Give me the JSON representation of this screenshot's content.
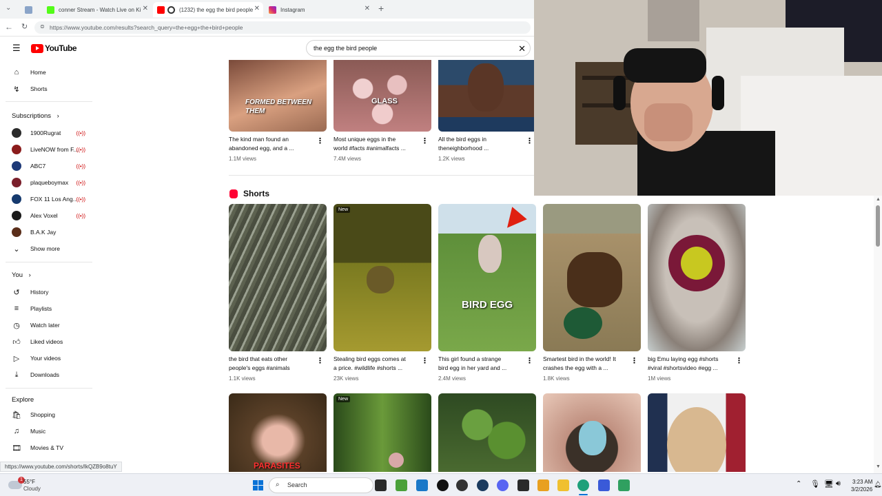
{
  "browser": {
    "tabs": [
      {
        "label": ""
      },
      {
        "label": "conner Stream - Watch Live on Ki"
      },
      {
        "label": "(1232) the egg the bird people"
      },
      {
        "label": "Instagram"
      }
    ],
    "url": "https://www.youtube.com/results?search_query=the+egg+the+bird+people"
  },
  "youtube": {
    "logo": "YouTube",
    "search_value": "the egg the bird people"
  },
  "sidebar": {
    "main": [
      {
        "label": "Home",
        "icon": "home-icon"
      },
      {
        "label": "Shorts",
        "icon": "shorts-icon"
      }
    ],
    "subscriptions_title": "Subscriptions",
    "subscriptions": [
      {
        "label": "1900Rugrat",
        "color": "#2b2b2b",
        "live": true
      },
      {
        "label": "LiveNOW from F...",
        "color": "#8b1c1c",
        "live": true
      },
      {
        "label": "ABC7",
        "color": "#1e3a78",
        "live": true
      },
      {
        "label": "plaqueboymax",
        "color": "#7a1f2b",
        "live": true
      },
      {
        "label": "FOX 11 Los Ang...",
        "color": "#163a6e",
        "live": true
      },
      {
        "label": "Alex Voxel",
        "color": "#1a1a1a",
        "live": true
      },
      {
        "label": "B.A.K Jay",
        "color": "#5a2e1a",
        "live": false
      }
    ],
    "show_more": "Show more",
    "you_title": "You",
    "you": [
      {
        "label": "History",
        "icon": "history-icon"
      },
      {
        "label": "Playlists",
        "icon": "playlists-icon"
      },
      {
        "label": "Watch later",
        "icon": "watch-later-icon"
      },
      {
        "label": "Liked videos",
        "icon": "liked-icon"
      },
      {
        "label": "Your videos",
        "icon": "your-videos-icon"
      },
      {
        "label": "Downloads",
        "icon": "downloads-icon"
      }
    ],
    "explore_title": "Explore",
    "explore": [
      {
        "label": "Shopping",
        "icon": "shopping-icon"
      },
      {
        "label": "Music",
        "icon": "music-icon"
      },
      {
        "label": "Movies & TV",
        "icon": "movies-icon"
      }
    ]
  },
  "top_row": [
    {
      "title1": "The kind man found an",
      "title2": "abandoned egg, and a ...",
      "views": "1.1M views",
      "overlay": "FORMED BETWEEN THEM",
      "bg": "#c98a6a"
    },
    {
      "title1": "Most unique eggs in the",
      "title2": "world  #facts #animalfacts ...",
      "views": "7.4M views",
      "overlay": "GLASS",
      "bg": "#b07a70"
    },
    {
      "title1": "All the bird eggs in",
      "title2": "theneighborhood ...",
      "views": "1.2K views",
      "overlay": "",
      "bg": "#3a5a7a"
    }
  ],
  "shorts_title": "Shorts",
  "shorts_row1": [
    {
      "title1": "the bird that eats other",
      "title2": "people's eggs #animals",
      "views": "1.1K views",
      "new": "",
      "overlay": "",
      "bg": "#6b7060"
    },
    {
      "title1": "Stealing bird eggs comes at",
      "title2": "a price. #wildlife #shorts ...",
      "views": "23K views",
      "new": "New",
      "overlay": "",
      "bg": "#6b6a2a"
    },
    {
      "title1": "This girl found a strange",
      "title2": "bird egg in her yard and ...",
      "views": "2.4M views",
      "new": "",
      "overlay": "BIRD EGG",
      "bg": "#5f8a3a"
    },
    {
      "title1": "Smartest bird in the world! It",
      "title2": "crashes the egg with a ...",
      "views": "1.8K views",
      "new": "",
      "overlay": "",
      "bg": "#8a7a55"
    },
    {
      "title1": "big Emu laying egg #shorts",
      "title2": "#viral #shortsvideo #egg ...",
      "views": "1M views",
      "new": "",
      "overlay": "",
      "bg": "#b8b0a2"
    }
  ],
  "shorts_row2": [
    {
      "new": "",
      "overlay": "PARASITES",
      "bg": "#6b5540"
    },
    {
      "new": "New",
      "overlay": "",
      "bg": "#4a6a30"
    },
    {
      "new": "",
      "overlay": "",
      "bg": "#3f6a2e"
    },
    {
      "new": "",
      "overlay": "",
      "bg": "#a08070"
    },
    {
      "new": "",
      "overlay": "",
      "bg": "#d8c0a0"
    }
  ],
  "status_url": "https://www.youtube.com/shorts/lkQZB9o8tuY",
  "taskbar": {
    "weather_temp": "55°F",
    "weather_desc": "Cloudy",
    "weather_badge": "1",
    "search_label": "Search",
    "time": "3:23 AM",
    "date": "3/2/2026"
  }
}
